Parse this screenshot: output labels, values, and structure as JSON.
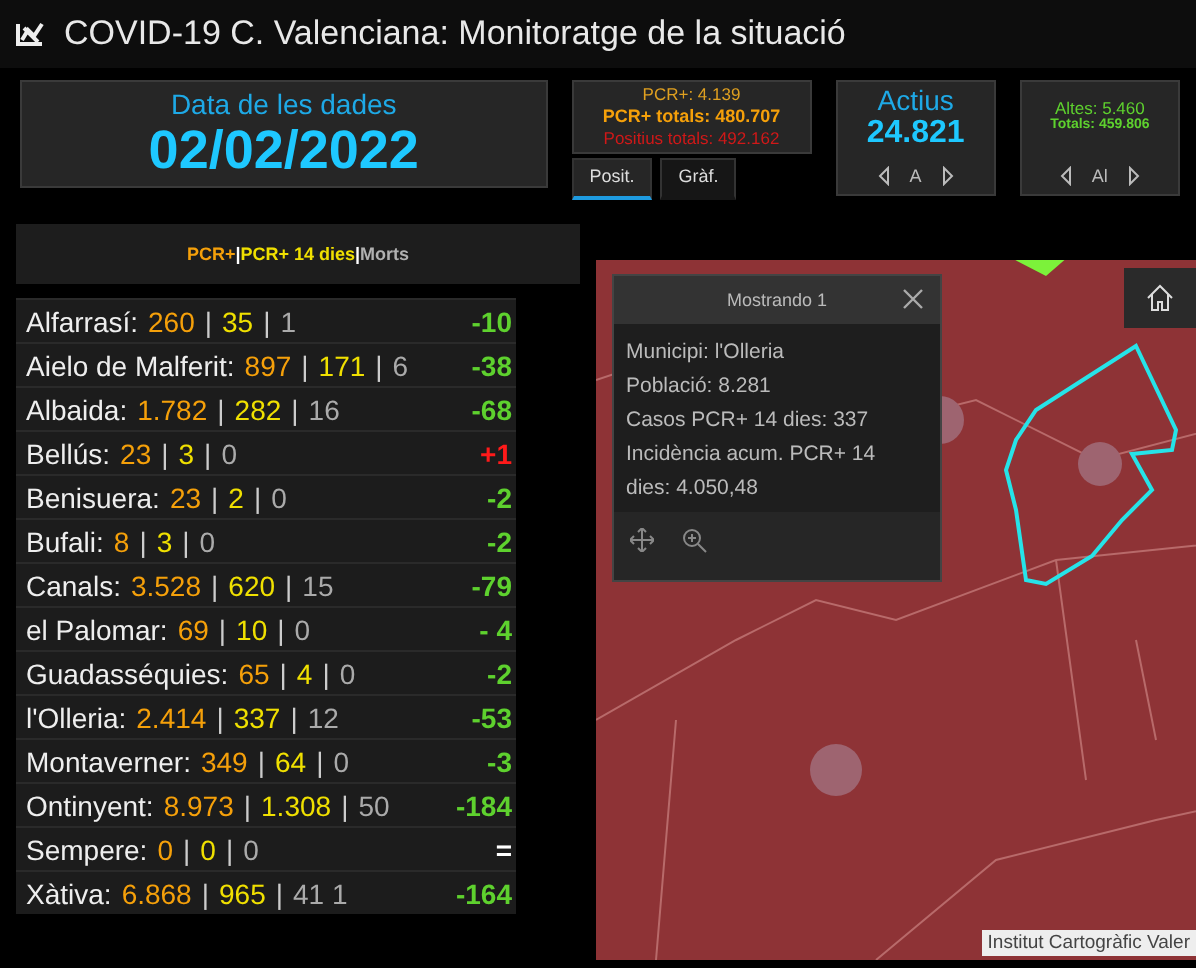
{
  "window": {
    "title": "COVID-19 C. Valenciana: Monitoratge de la situació"
  },
  "date_panel": {
    "label": "Data de les dades",
    "value": "02/02/2022"
  },
  "pcr_panel": {
    "pcr": "PCR+: 4.139",
    "pcr_total": "PCR+ totals: 480.707",
    "positive_total": "Positius totals: 492.162"
  },
  "tabs": [
    {
      "label": "Posit.",
      "selected": true
    },
    {
      "label": "Gràf.",
      "selected": false
    }
  ],
  "actius": {
    "label": "Actius",
    "value": "24.821",
    "nav_label": "A"
  },
  "altes": {
    "label": "Altes: 5.460",
    "totals": "Totals: 459.806",
    "nav_label": "Al"
  },
  "list": {
    "legend": [
      {
        "text": "PCR+",
        "color": "#f5a00a"
      },
      {
        "text": "|",
        "color": "#ffffff"
      },
      {
        "text": "PCR+ 14 dies",
        "color": "#f0e000"
      },
      {
        "text": "|",
        "color": "#ffffff"
      },
      {
        "text": "Morts",
        "color": "#b0b0b0"
      }
    ],
    "separator": "|",
    "rows": [
      {
        "name": "Alfarrasí:",
        "pcr": "260",
        "pcr14": "35",
        "deaths": "1",
        "change": "-10",
        "color": "#5ed12e"
      },
      {
        "name": "Aielo de Malferit:",
        "pcr": "897",
        "pcr14": "171",
        "deaths": "6",
        "change": "-38",
        "color": "#5ed12e"
      },
      {
        "name": "Albaida:",
        "pcr": "1.782",
        "pcr14": "282",
        "deaths": "16",
        "change": "-68",
        "color": "#5ed12e"
      },
      {
        "name": "Bellús:",
        "pcr": "23",
        "pcr14": "3",
        "deaths": "0",
        "change": "+1",
        "color": "#ff1a1a"
      },
      {
        "name": "Benisuera:",
        "pcr": "23",
        "pcr14": "2",
        "deaths": "0",
        "change": "-2",
        "color": "#5ed12e"
      },
      {
        "name": "Bufali:",
        "pcr": "8",
        "pcr14": "3",
        "deaths": "0",
        "change": "-2",
        "color": "#5ed12e"
      },
      {
        "name": "Canals:",
        "pcr": "3.528",
        "pcr14": "620",
        "deaths": "15",
        "change": "-79",
        "color": "#5ed12e"
      },
      {
        "name": "el Palomar:",
        "pcr": "69",
        "pcr14": "10",
        "deaths": "0",
        "change": "- 4",
        "color": "#5ed12e"
      },
      {
        "name": "Guadasséquies:",
        "pcr": "65",
        "pcr14": "4",
        "deaths": "0",
        "change": "-2",
        "color": "#5ed12e"
      },
      {
        "name": "l'Olleria:",
        "pcr": "2.414",
        "pcr14": "337",
        "deaths": "12",
        "change": "-53",
        "color": "#5ed12e"
      },
      {
        "name": "Montaverner:",
        "pcr": "349",
        "pcr14": "64",
        "deaths": "0",
        "change": "-3",
        "color": "#5ed12e"
      },
      {
        "name": "Ontinyent:",
        "pcr": "8.973",
        "pcr14": "1.308",
        "deaths": "50",
        "change": "-184",
        "color": "#5ed12e"
      },
      {
        "name": "Sempere:",
        "pcr": "0",
        "pcr14": "0",
        "deaths": "0",
        "change": "=",
        "color": "#ffffff"
      },
      {
        "name": "Xàtiva:",
        "pcr": "6.868",
        "pcr14": "965",
        "deaths": "41 1",
        "change": "-164",
        "color": "#5ed12e"
      }
    ]
  },
  "map": {
    "kind": "picture",
    "popup": {
      "title": "Mostrando 1",
      "lines": [
        "Municipi: l'Olleria",
        "Població: 8.281",
        "Casos PCR+ 14 dies: 337",
        "Incidència acum. PCR+ 14 dies: 4.050,48"
      ]
    },
    "attribution": "Institut Cartogràfic Valer"
  }
}
